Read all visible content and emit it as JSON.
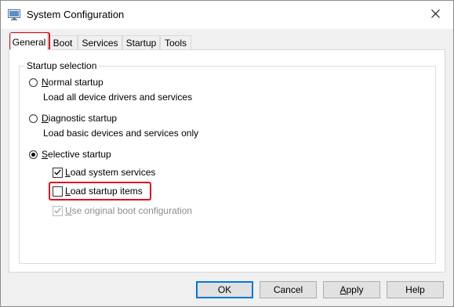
{
  "window": {
    "title": "System Configuration",
    "close_glyph": "✕"
  },
  "tabs": [
    {
      "label": "General",
      "selected": true
    },
    {
      "label": "Boot",
      "selected": false
    },
    {
      "label": "Services",
      "selected": false
    },
    {
      "label": "Startup",
      "selected": false
    },
    {
      "label": "Tools",
      "selected": false
    }
  ],
  "startup_selection": {
    "legend": "Startup selection",
    "normal": {
      "label": "Normal startup",
      "description": "Load all device drivers and services",
      "selected": false
    },
    "diagnostic": {
      "label": "Diagnostic startup",
      "description": "Load basic devices and services only",
      "selected": false
    },
    "selective": {
      "label": "Selective startup",
      "selected": true,
      "options": {
        "load_system_services": {
          "label": "Load system services",
          "checked": true,
          "enabled": true
        },
        "load_startup_items": {
          "label": "Load startup items",
          "checked": false,
          "enabled": true
        },
        "use_original_boot": {
          "label": "Use original boot configuration",
          "checked": true,
          "enabled": false
        }
      }
    }
  },
  "buttons": {
    "ok": "OK",
    "cancel": "Cancel",
    "apply": "Apply",
    "help": "Help"
  },
  "colors": {
    "highlight": "#e3101c",
    "window_bg": "#f0f0f0",
    "panel_bg": "#ffffff"
  },
  "icons": {
    "app": "system-configuration-icon",
    "close": "close-icon",
    "check": "checkmark-icon"
  }
}
